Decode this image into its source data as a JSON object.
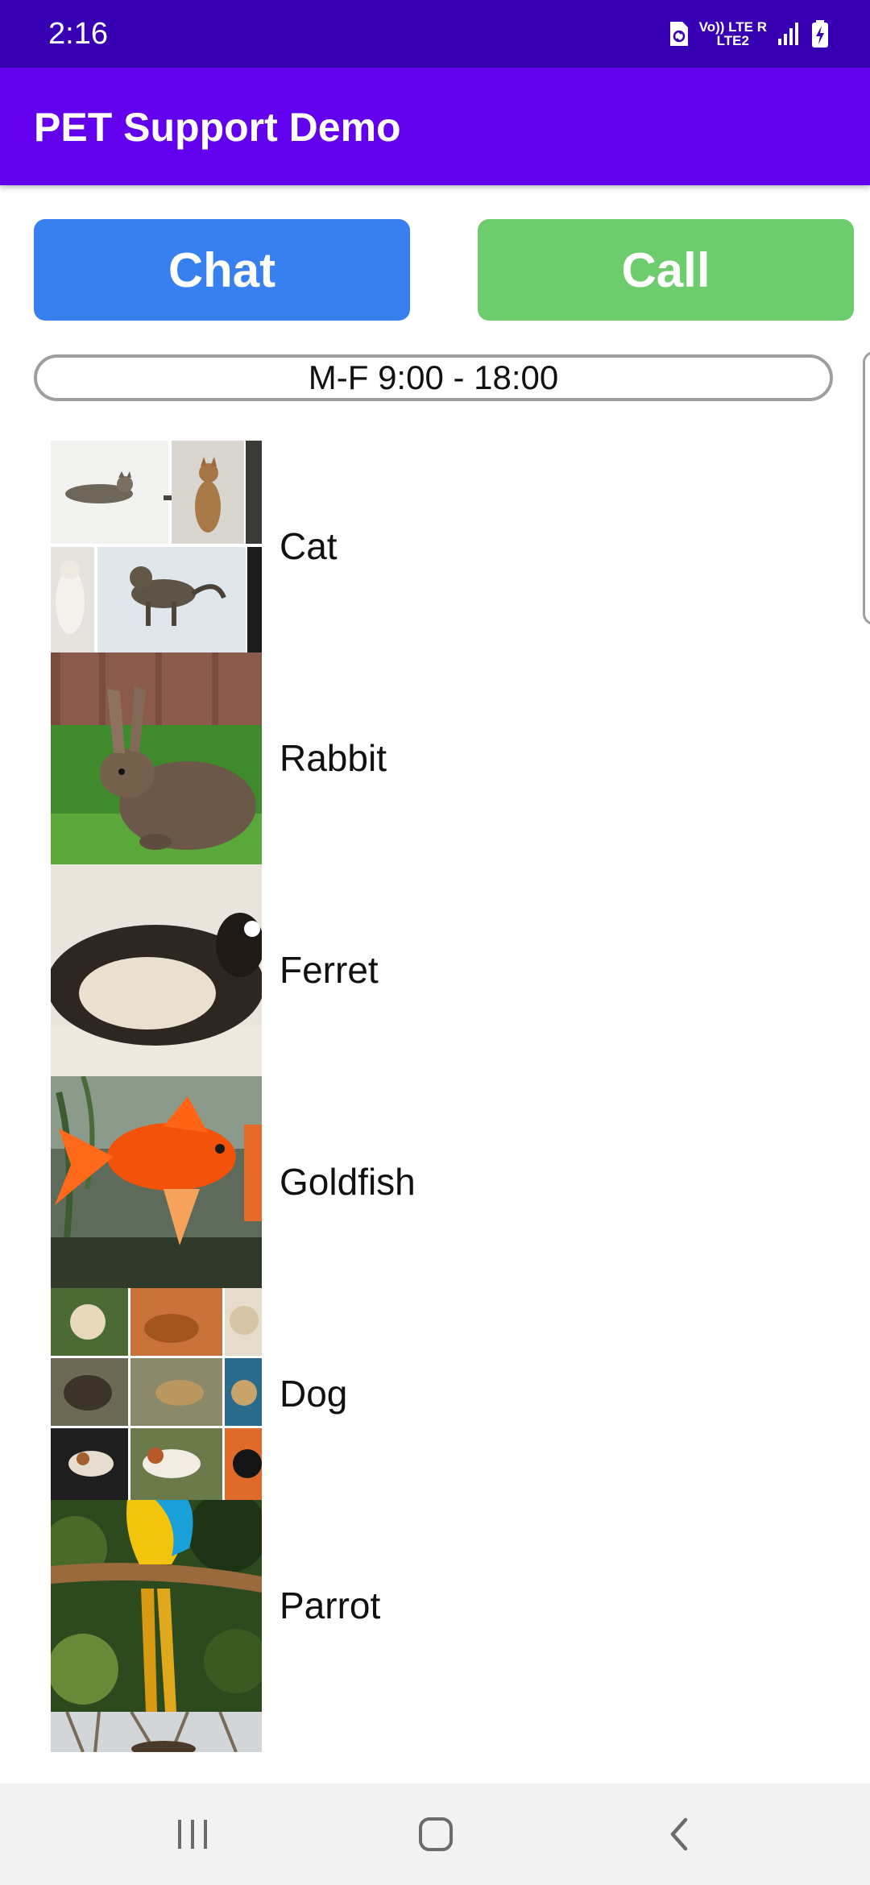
{
  "status_bar": {
    "time": "2:16",
    "network_top": "Vo)) LTE R",
    "network_bottom": "LTE2",
    "icons": [
      "sim-icon",
      "volte-icon",
      "lte-icon",
      "signal-icon",
      "battery-charging-icon"
    ]
  },
  "app_bar": {
    "title": "PET Support Demo",
    "color": "#6200ee"
  },
  "actions": {
    "chat_label": "Chat",
    "call_label": "Call",
    "chat_color": "#3880f0",
    "call_color": "#6dcc6b"
  },
  "hours": {
    "text": "M-F 9:00 - 18:00"
  },
  "pets": [
    {
      "label": "Cat",
      "image": "cat-collage-image"
    },
    {
      "label": "Rabbit",
      "image": "rabbit-photo"
    },
    {
      "label": "Ferret",
      "image": "ferret-photo"
    },
    {
      "label": "Goldfish",
      "image": "goldfish-photo"
    },
    {
      "label": "Dog",
      "image": "dog-collage-image"
    },
    {
      "label": "Parrot",
      "image": "parrot-photo"
    },
    {
      "label": "",
      "image": "partial-photo"
    }
  ],
  "nav_bar": {
    "icons": [
      "recents-icon",
      "home-icon",
      "back-icon"
    ]
  }
}
